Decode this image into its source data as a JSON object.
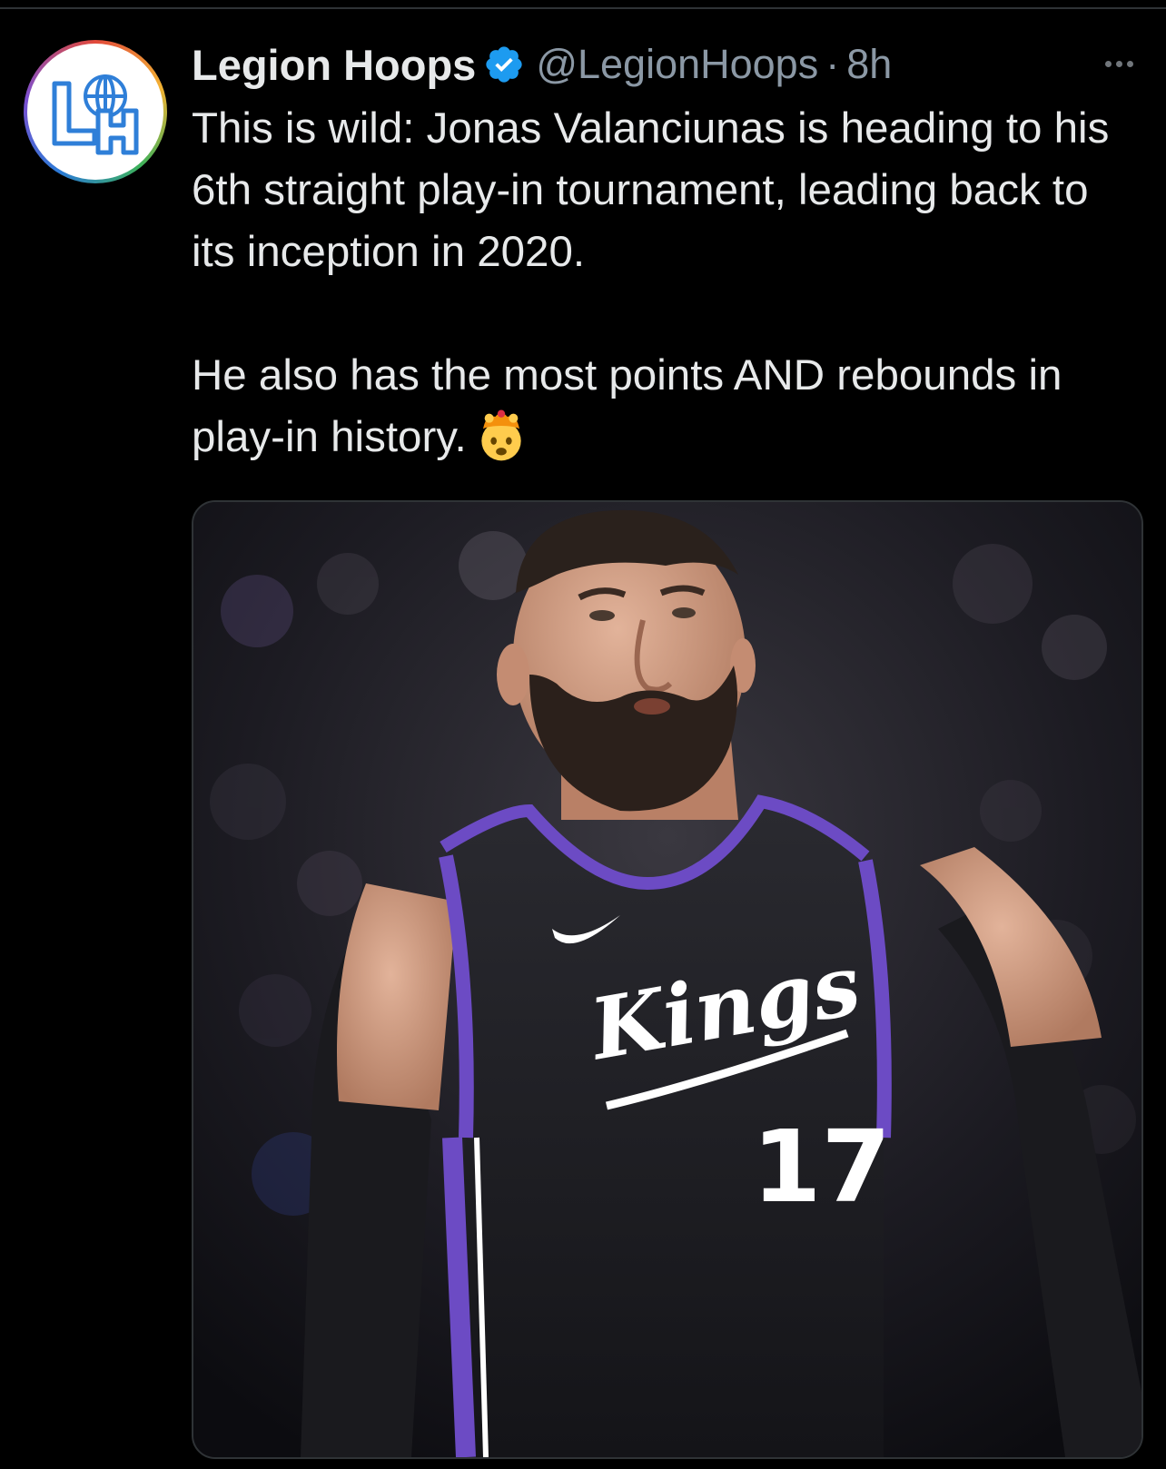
{
  "tweet": {
    "author": {
      "display_name": "Legion Hoops",
      "handle": "@LegionHoops",
      "verified": true,
      "avatar_logo": "LH",
      "avatar_ring_colors": [
        "#e24a3b",
        "#f2b233",
        "#3db15a",
        "#2b7bd6",
        "#7b4fd1"
      ]
    },
    "separator": "·",
    "timestamp": "8h",
    "text_paragraph_1": "This is wild: Jonas Valanciunas is heading to his 6th straight play-in tournament, leading back to its inception in 2020.",
    "text_paragraph_2": "He also has the most points AND rebounds in play-in history.",
    "emoji": "exploding-head-emoji",
    "media": {
      "type": "photo",
      "jersey_text": "Kings",
      "jersey_number": "17"
    }
  },
  "colors": {
    "background": "#000000",
    "text_primary": "#e7e9ea",
    "text_secondary": "#8b98a5",
    "verified_blue": "#1d9bf0",
    "kings_purple": "#6c4bc4"
  }
}
